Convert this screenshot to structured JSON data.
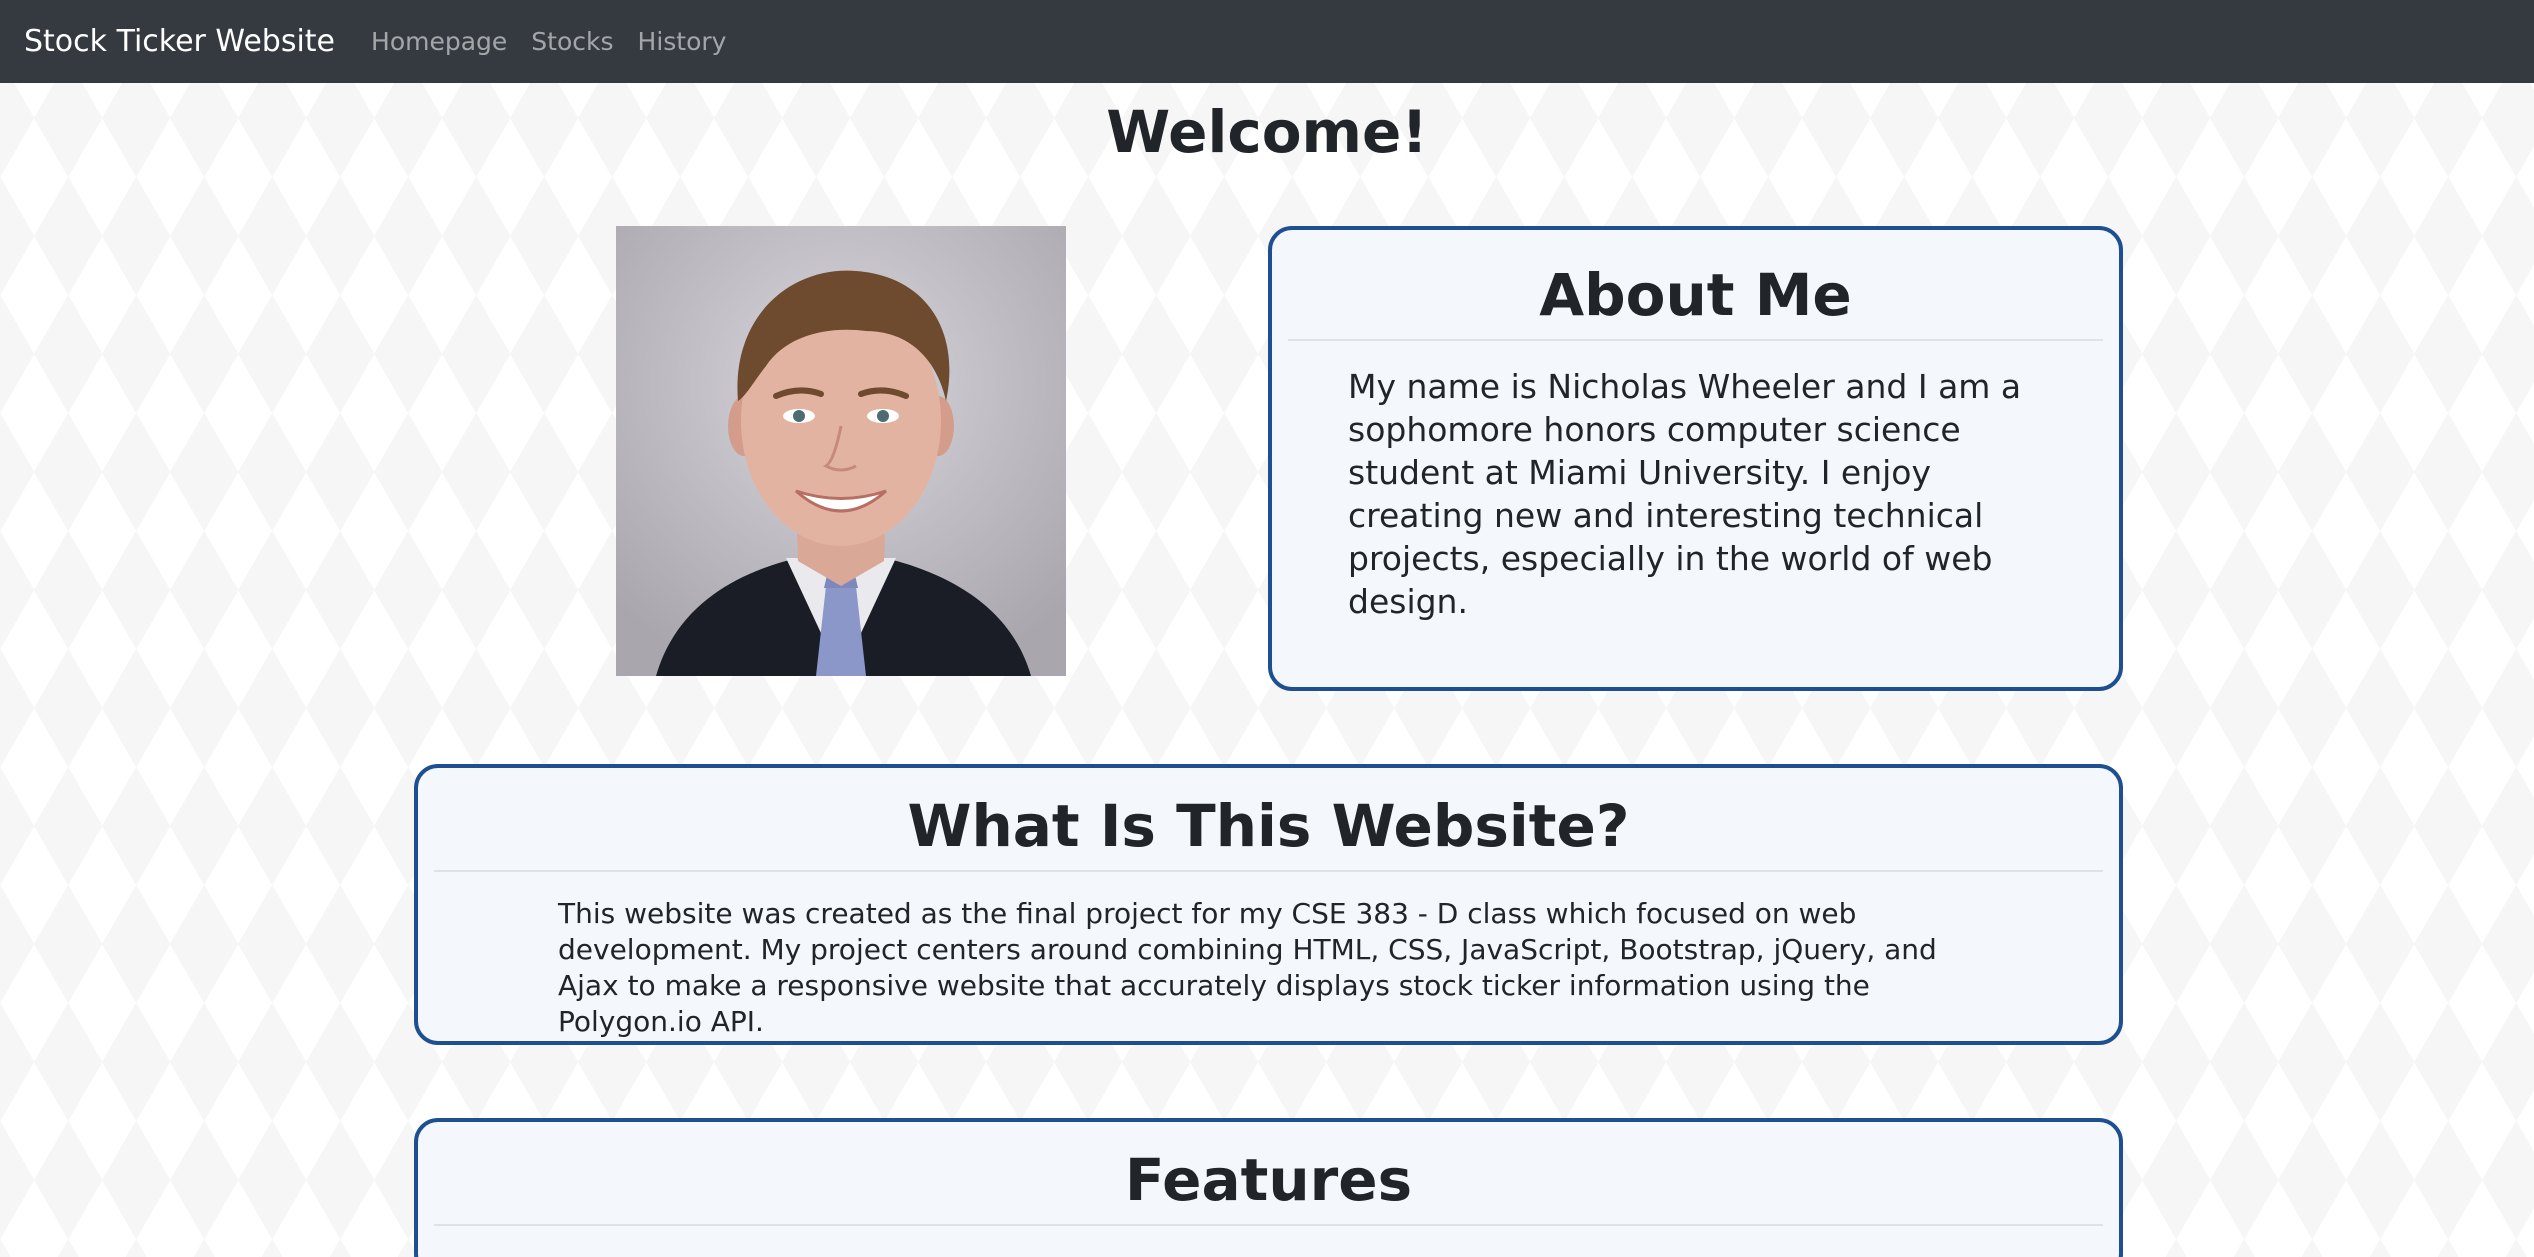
{
  "navbar": {
    "brand": "Stock Ticker Website",
    "links": [
      "Homepage",
      "Stocks",
      "History"
    ]
  },
  "page": {
    "title": "Welcome!"
  },
  "about": {
    "title": "About Me",
    "body": "My name is Nicholas Wheeler and I am a sophomore honors computer science student at Miami University. I enjoy creating new and interesting technical projects, especially in the world of web design."
  },
  "what": {
    "title": "What Is This Website?",
    "body": "This website was created as the final project for my CSE 383 - D class which focused on web development. My project centers around combining HTML, CSS, JavaScript, Bootstrap, jQuery, and Ajax to make a responsive website that accurately displays stock ticker information using the Polygon.io API."
  },
  "features": {
    "title": "Features"
  },
  "colors": {
    "navbar": "#343a40",
    "card_border": "#1d4f91",
    "card_background": "#f4f8fd"
  }
}
